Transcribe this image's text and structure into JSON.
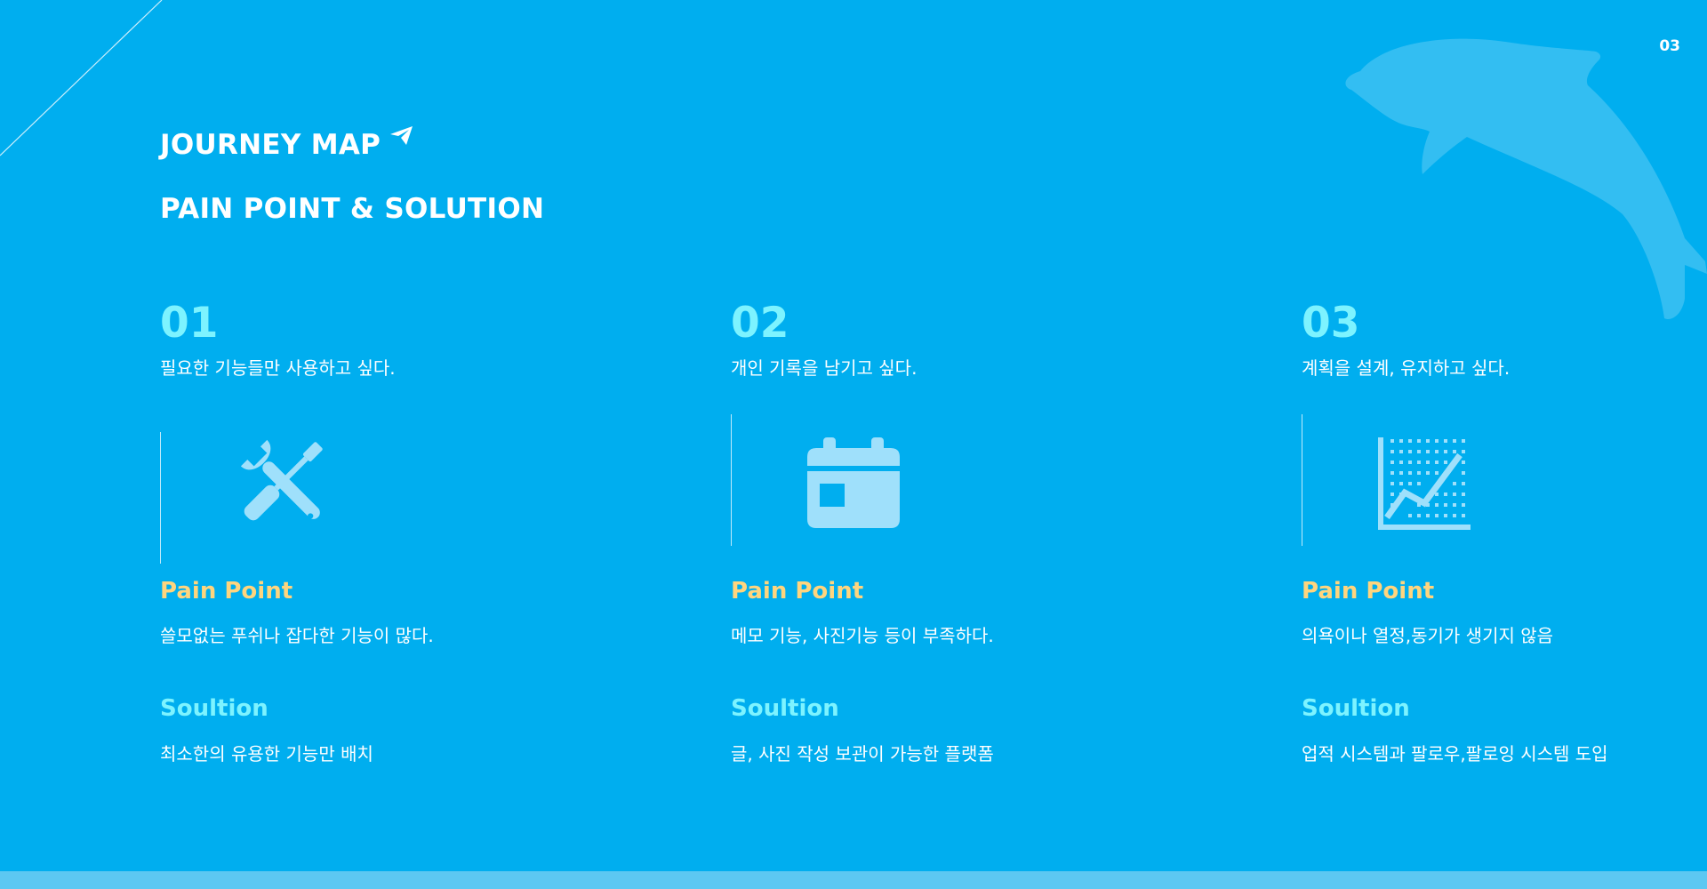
{
  "page_number": "03",
  "header": {
    "title": "JOURNEY MAP",
    "subtitle": "PAIN POINT & SOLUTION"
  },
  "icons": {
    "title_icon": "paper-plane-icon",
    "decoration": "dolphin-icon"
  },
  "colors": {
    "background": "#00aeef",
    "number_accent": "#7df3ff",
    "pain_label": "#ffd57e",
    "solution_label": "#7df3ff",
    "icon_fill": "#9fe0fb",
    "bottom_bar": "#5cc8f2"
  },
  "columns": [
    {
      "number": "01",
      "description": "필요한 기능들만 사용하고 싶다.",
      "icon": "tools-icon",
      "pain_label": "Pain Point",
      "pain_text": "쓸모없는 푸쉬나 잡다한 기능이 많다.",
      "solution_label": "Soultion",
      "solution_text": "최소한의 유용한 기능만 배치"
    },
    {
      "number": "02",
      "description": "개인 기록을 남기고 싶다.",
      "icon": "calendar-icon",
      "pain_label": "Pain Point",
      "pain_text": "메모 기능, 사진기능 등이 부족하다.",
      "solution_label": "Soultion",
      "solution_text": "글, 사진 작성 보관이 가능한 플랫폼"
    },
    {
      "number": "03",
      "description": "계획을 설계, 유지하고 싶다.",
      "icon": "line-chart-icon",
      "pain_label": "Pain Point",
      "pain_text": "의욕이나 열정,동기가 생기지 않음",
      "solution_label": "Soultion",
      "solution_text": "업적 시스템과 팔로우,팔로잉 시스템 도입"
    }
  ]
}
